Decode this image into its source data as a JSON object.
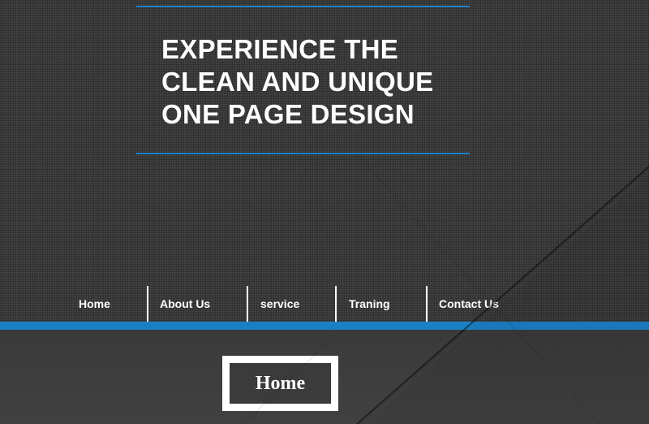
{
  "hero": {
    "headline_lines": [
      "EXPERIENCE THE",
      "CLEAN AND UNIQUE",
      "ONE PAGE DESIGN"
    ]
  },
  "nav": {
    "items": [
      {
        "label": "Home"
      },
      {
        "label": "About Us"
      },
      {
        "label": "service"
      },
      {
        "label": "Traning"
      },
      {
        "label": "Contact Us"
      }
    ]
  },
  "section": {
    "title": "Home"
  },
  "colors": {
    "accent_blue": "#1a80c5",
    "background_dark": "#3b3b3b",
    "text": "#ffffff"
  }
}
